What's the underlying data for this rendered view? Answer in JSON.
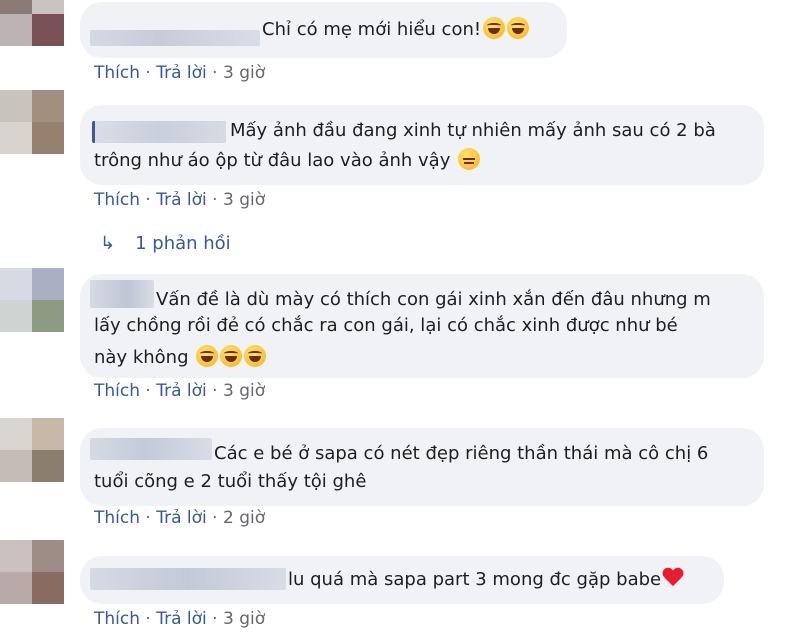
{
  "comments": [
    {
      "text_lines": [
        "Chỉ có mẹ mới hiểu con!"
      ],
      "emojis": [
        "rolling-laughing-icon",
        "rolling-laughing-icon"
      ],
      "actions": {
        "like": "Thích",
        "reply": "Trả lời",
        "time": "3 giờ"
      },
      "avatar_colors": [
        "#8c7a77",
        "#c9c3c1",
        "#bcb3b4",
        "#7a5256"
      ]
    },
    {
      "text_lines": [
        "Mấy ảnh đầu đang xinh tự nhiên mấy ảnh sau có 2 bà",
        "trông như áo ộp từ đâu lao vào ảnh vậy"
      ],
      "emojis": [
        "unamused-face-icon"
      ],
      "actions": {
        "like": "Thích",
        "reply": "Trả lời",
        "time": "3 giờ"
      },
      "avatar_colors": [
        "#c9c3bd",
        "#a38f7e",
        "#d9d3cf",
        "#96806e"
      ]
    },
    {
      "text_lines": [
        "Vấn đề là dù mày có thích con gái xinh xắn đến đâu nhưng m",
        "lấy chồng rồi đẻ có chắc ra con gái, lại có chắc xinh được như bé",
        "này không"
      ],
      "emojis": [
        "tears-of-joy-icon",
        "tears-of-joy-icon",
        "tears-of-joy-icon"
      ],
      "actions": {
        "like": "Thích",
        "reply": "Trả lời",
        "time": "3 giờ"
      },
      "avatar_colors": [
        "#d7dae3",
        "#a9b0c4",
        "#cfd3d2",
        "#8d9b80"
      ]
    },
    {
      "text_lines": [
        "Các e bé ở sapa có nét đẹp riêng thần thái mà cô chị 6",
        "tuổi cõng e 2 tuổi thấy tội ghê"
      ],
      "emojis": [],
      "actions": {
        "like": "Thích",
        "reply": "Trả lời",
        "time": "2 giờ"
      },
      "avatar_colors": [
        "#d8d4d0",
        "#c7b8a8",
        "#c4bdb7",
        "#8c7e6e"
      ]
    },
    {
      "text_lines": [
        "lu quá mà sapa part 3 mong đc gặp babe"
      ],
      "emojis": [
        "red-heart-icon"
      ],
      "actions": {
        "like": "Thích",
        "reply": "Trả lời",
        "time": "3 giờ"
      },
      "avatar_colors": [
        "#c8c1c0",
        "#9e8c87",
        "#b8aaa8",
        "#8a6b62"
      ]
    }
  ],
  "reply_link": {
    "label": "1 phản hồi",
    "icon": "reply-arrow-icon"
  },
  "colors": {
    "bubble": "#f0f2f5",
    "link": "#385898",
    "muted": "#65676b",
    "text": "#1c1e21"
  }
}
